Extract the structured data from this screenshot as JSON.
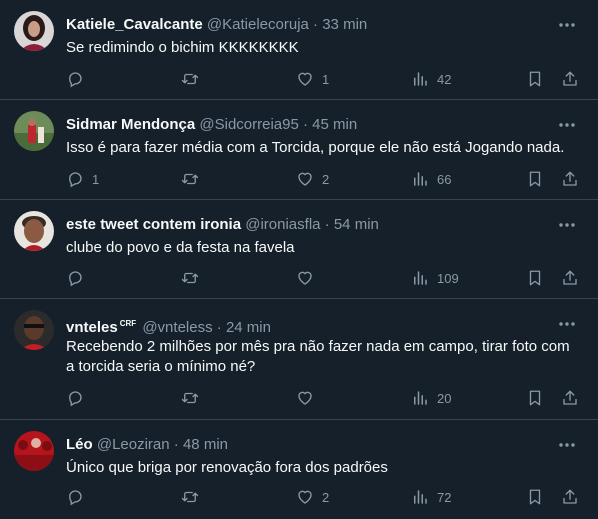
{
  "tweets": [
    {
      "name": "Katiele_Cavalcante",
      "handle": "@Katielecoruja",
      "separator": "·",
      "time": "33 min",
      "text": "Se redimindo o bichim KKKKKKKK",
      "replies": "",
      "retweets": "",
      "likes": "1",
      "views": "42",
      "badge": ""
    },
    {
      "name": "Sidmar Mendonça",
      "handle": "@Sidcorreia95",
      "separator": "·",
      "time": "45 min",
      "text": "Isso é para fazer média com a Torcida, porque ele não está Jogando nada.",
      "replies": "1",
      "retweets": "",
      "likes": "2",
      "views": "66",
      "badge": ""
    },
    {
      "name": "este tweet contem ironia",
      "handle": "@ironiasfla",
      "separator": "·",
      "time": "54 min",
      "text": "clube do povo e da festa na favela",
      "replies": "",
      "retweets": "",
      "likes": "",
      "views": "109",
      "badge": ""
    },
    {
      "name": "vnteles",
      "badge": "CRF",
      "handle": "@vnteless",
      "separator": "·",
      "time": "24 min",
      "text": "Recebendo 2 milhões por mês pra não fazer nada em campo, tirar foto com a torcida seria o mínimo né?",
      "replies": "",
      "retweets": "",
      "likes": "",
      "views": "20"
    },
    {
      "name": "Léo",
      "handle": "@Leoziran",
      "separator": "·",
      "time": "48 min",
      "text": "Único que briga por renovação fora dos padrões",
      "replies": "",
      "retweets": "",
      "likes": "2",
      "views": "72",
      "badge": ""
    }
  ],
  "icons": {
    "more": "more-horizontal-icon",
    "reply": "reply-icon",
    "retweet": "retweet-icon",
    "like": "heart-icon",
    "views": "views-bar-chart-icon",
    "bookmark": "bookmark-icon",
    "share": "share-icon"
  },
  "colors": {
    "background": "#15202b",
    "text": "#f7f9f9",
    "secondary": "#8b98a5",
    "border": "#38444d"
  }
}
